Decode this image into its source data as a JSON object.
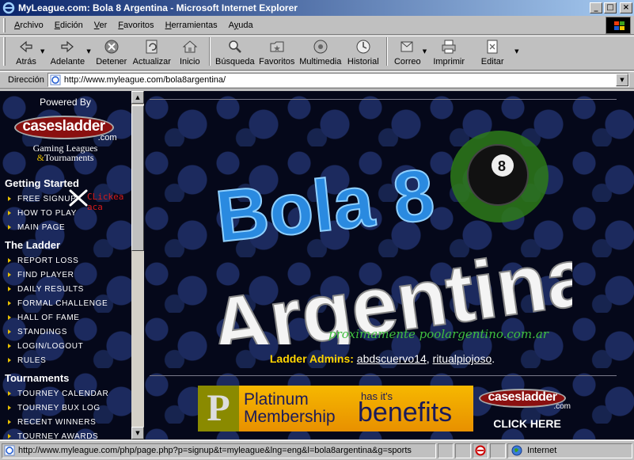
{
  "window": {
    "title": "MyLeague.com: Bola 8 Argentina - Microsoft Internet Explorer",
    "buttons": {
      "minimize": "_",
      "maximize": "□",
      "close": "×"
    }
  },
  "menubar": {
    "items": [
      {
        "label": "Archivo",
        "key": "A",
        "rest": "rchivo"
      },
      {
        "label": "Edición",
        "key": "E",
        "rest": "dición"
      },
      {
        "label": "Ver",
        "key": "V",
        "rest": "er"
      },
      {
        "label": "Favoritos",
        "key": "F",
        "rest": "avoritos"
      },
      {
        "label": "Herramientas",
        "key": "H",
        "rest": "erramientas"
      },
      {
        "label": "Ayuda",
        "key": "y",
        "pre": "A",
        "rest": "uda"
      }
    ]
  },
  "toolbar": {
    "back": "Atrás",
    "forward": "Adelante",
    "stop": "Detener",
    "refresh": "Actualizar",
    "home": "Inicio",
    "search": "Búsqueda",
    "favorites": "Favoritos",
    "media": "Multimedia",
    "history": "Historial",
    "mail": "Correo",
    "print": "Imprimir",
    "edit": "Editar"
  },
  "address": {
    "label": "Dirección",
    "url": "http://www.myleague.com/bola8argentina/"
  },
  "sidebar": {
    "powered_by": "Powered By",
    "logo_text": "casesladder",
    "logo_com": ".com",
    "logo_sub1": "Gaming Leagues",
    "logo_sub_amp": "&",
    "logo_sub2": "Tournaments",
    "sections": [
      {
        "heading": "Getting Started",
        "items": [
          "FREE SIGNUP",
          "HOW TO PLAY",
          "MAIN PAGE"
        ]
      },
      {
        "heading": "The Ladder",
        "items": [
          "REPORT LOSS",
          "FIND PLAYER",
          "DAILY RESULTS",
          "FORMAL CHALLENGE",
          "HALL OF FAME",
          "STANDINGS",
          "LOGIN/LOGOUT",
          "RULES"
        ]
      },
      {
        "heading": "Tournaments",
        "items": [
          "TOURNEY CALENDAR",
          "TOURNEY BUX LOG",
          "RECENT WINNERS",
          "TOURNEY AWARDS"
        ]
      }
    ],
    "annotation": "CLickea aca"
  },
  "main": {
    "banner_line1": "Bola 8",
    "banner_line2": "Argentina",
    "ball_number": "8",
    "tagline": "proximamente poolargentino.com.ar",
    "admins_label": "Ladder Admins:",
    "admins": [
      "abdscuervo14",
      "ritualpiojoso"
    ],
    "admins_sep": ",",
    "admins_end": ".",
    "ad": {
      "p": "P",
      "line1": "Platinum",
      "line2": "Membership",
      "small": "has it's",
      "big": "benefits",
      "logo_text": "casesladder",
      "logo_com": ".com",
      "cta": "CLICK HERE"
    }
  },
  "statusbar": {
    "url": "http://www.myleague.com/php/page.php?p=signup&t=myleague&lng=eng&l=bola8argentina&g=sports",
    "zone": "Internet"
  }
}
